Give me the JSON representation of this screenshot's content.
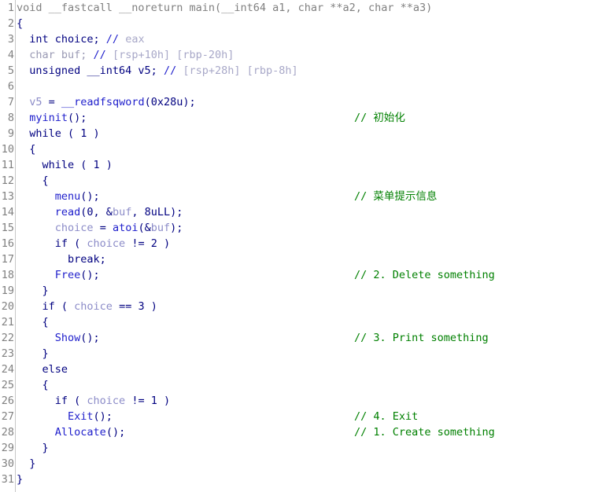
{
  "view": {
    "name": "pseudocode-view",
    "kind": "decompiler-pseudocode",
    "total_lines": 31,
    "colors": {
      "background": "#ffffff",
      "line_number": "#808080",
      "gutter_separator": "#c8c8c8",
      "keyword": "#000080",
      "function": "#2020cc",
      "local_variable": "#8c8cc8",
      "comment_slashes": "#2020cc",
      "comment_text": "#a8a8c8",
      "user_comment": "#008000",
      "prototype_dim": "#808080"
    }
  },
  "lines": [
    {
      "num": "1",
      "tokens": [
        {
          "t": "void __fastcall __noreturn main(__int64 a1, char **a2, char **a3)",
          "c": "t-proto"
        }
      ],
      "comment": ""
    },
    {
      "num": "2",
      "tokens": [
        {
          "t": "{",
          "c": "t-punct"
        }
      ],
      "comment": ""
    },
    {
      "num": "3",
      "tokens": [
        {
          "t": "  int choice; ",
          "c": "t-keyword"
        },
        {
          "t": "// ",
          "c": "t-cmt"
        },
        {
          "t": "eax",
          "c": "t-cmtbody"
        }
      ],
      "comment": ""
    },
    {
      "num": "4",
      "tokens": [
        {
          "t": "  char buf; ",
          "c": "t-dim"
        },
        {
          "t": "// ",
          "c": "t-cmt"
        },
        {
          "t": "[rsp+10h] [rbp-20h]",
          "c": "t-cmtbody"
        }
      ],
      "comment": ""
    },
    {
      "num": "5",
      "tokens": [
        {
          "t": "  unsigned __int64 v5; ",
          "c": "t-keyword"
        },
        {
          "t": "// ",
          "c": "t-cmt"
        },
        {
          "t": "[rsp+28h] [rbp-8h]",
          "c": "t-cmtbody"
        }
      ],
      "comment": ""
    },
    {
      "num": "6",
      "tokens": [],
      "comment": ""
    },
    {
      "num": "7",
      "tokens": [
        {
          "t": "  ",
          "c": "t-plain"
        },
        {
          "t": "v5",
          "c": "t-var"
        },
        {
          "t": " = ",
          "c": "t-punct"
        },
        {
          "t": "__readfsqword",
          "c": "t-func"
        },
        {
          "t": "(0x28u);",
          "c": "t-punct"
        }
      ],
      "comment": ""
    },
    {
      "num": "8",
      "tokens": [
        {
          "t": "  ",
          "c": "t-plain"
        },
        {
          "t": "myinit",
          "c": "t-func"
        },
        {
          "t": "();",
          "c": "t-punct"
        }
      ],
      "comment": "// 初始化"
    },
    {
      "num": "9",
      "tokens": [
        {
          "t": "  while ( 1 )",
          "c": "t-keyword"
        }
      ],
      "comment": ""
    },
    {
      "num": "10",
      "tokens": [
        {
          "t": "  {",
          "c": "t-punct"
        }
      ],
      "comment": ""
    },
    {
      "num": "11",
      "tokens": [
        {
          "t": "    while ( 1 )",
          "c": "t-keyword"
        }
      ],
      "comment": ""
    },
    {
      "num": "12",
      "tokens": [
        {
          "t": "    {",
          "c": "t-punct"
        }
      ],
      "comment": ""
    },
    {
      "num": "13",
      "tokens": [
        {
          "t": "      ",
          "c": "t-plain"
        },
        {
          "t": "menu",
          "c": "t-func"
        },
        {
          "t": "();",
          "c": "t-punct"
        }
      ],
      "comment": "// 菜单提示信息"
    },
    {
      "num": "14",
      "tokens": [
        {
          "t": "      ",
          "c": "t-plain"
        },
        {
          "t": "read",
          "c": "t-func"
        },
        {
          "t": "(0, &",
          "c": "t-punct"
        },
        {
          "t": "buf",
          "c": "t-var"
        },
        {
          "t": ", 8uLL);",
          "c": "t-punct"
        }
      ],
      "comment": ""
    },
    {
      "num": "15",
      "tokens": [
        {
          "t": "      ",
          "c": "t-plain"
        },
        {
          "t": "choice",
          "c": "t-var"
        },
        {
          "t": " = ",
          "c": "t-punct"
        },
        {
          "t": "atoi",
          "c": "t-func"
        },
        {
          "t": "(&",
          "c": "t-punct"
        },
        {
          "t": "buf",
          "c": "t-var"
        },
        {
          "t": ");",
          "c": "t-punct"
        }
      ],
      "comment": ""
    },
    {
      "num": "16",
      "tokens": [
        {
          "t": "      if ( ",
          "c": "t-keyword"
        },
        {
          "t": "choice",
          "c": "t-var"
        },
        {
          "t": " != 2 )",
          "c": "t-punct"
        }
      ],
      "comment": ""
    },
    {
      "num": "17",
      "tokens": [
        {
          "t": "        break;",
          "c": "t-keyword"
        }
      ],
      "comment": ""
    },
    {
      "num": "18",
      "tokens": [
        {
          "t": "      ",
          "c": "t-plain"
        },
        {
          "t": "Free",
          "c": "t-func"
        },
        {
          "t": "();",
          "c": "t-punct"
        }
      ],
      "comment": "// 2. Delete something"
    },
    {
      "num": "19",
      "tokens": [
        {
          "t": "    }",
          "c": "t-punct"
        }
      ],
      "comment": ""
    },
    {
      "num": "20",
      "tokens": [
        {
          "t": "    if ( ",
          "c": "t-keyword"
        },
        {
          "t": "choice",
          "c": "t-var"
        },
        {
          "t": " == 3 )",
          "c": "t-punct"
        }
      ],
      "comment": ""
    },
    {
      "num": "21",
      "tokens": [
        {
          "t": "    {",
          "c": "t-punct"
        }
      ],
      "comment": ""
    },
    {
      "num": "22",
      "tokens": [
        {
          "t": "      ",
          "c": "t-plain"
        },
        {
          "t": "Show",
          "c": "t-func"
        },
        {
          "t": "();",
          "c": "t-punct"
        }
      ],
      "comment": "// 3. Print something"
    },
    {
      "num": "23",
      "tokens": [
        {
          "t": "    }",
          "c": "t-punct"
        }
      ],
      "comment": ""
    },
    {
      "num": "24",
      "tokens": [
        {
          "t": "    else",
          "c": "t-keyword"
        }
      ],
      "comment": ""
    },
    {
      "num": "25",
      "tokens": [
        {
          "t": "    {",
          "c": "t-punct"
        }
      ],
      "comment": ""
    },
    {
      "num": "26",
      "tokens": [
        {
          "t": "      if ( ",
          "c": "t-keyword"
        },
        {
          "t": "choice",
          "c": "t-var"
        },
        {
          "t": " != 1 )",
          "c": "t-punct"
        }
      ],
      "comment": ""
    },
    {
      "num": "27",
      "tokens": [
        {
          "t": "        ",
          "c": "t-plain"
        },
        {
          "t": "Exit",
          "c": "t-func"
        },
        {
          "t": "();",
          "c": "t-punct"
        }
      ],
      "comment": "// 4. Exit"
    },
    {
      "num": "28",
      "tokens": [
        {
          "t": "      ",
          "c": "t-plain"
        },
        {
          "t": "Allocate",
          "c": "t-func"
        },
        {
          "t": "();",
          "c": "t-punct"
        }
      ],
      "comment": "// 1. Create something"
    },
    {
      "num": "29",
      "tokens": [
        {
          "t": "    }",
          "c": "t-punct"
        }
      ],
      "comment": ""
    },
    {
      "num": "30",
      "tokens": [
        {
          "t": "  }",
          "c": "t-punct"
        }
      ],
      "comment": ""
    },
    {
      "num": "31",
      "tokens": [
        {
          "t": "}",
          "c": "t-punct"
        }
      ],
      "comment": ""
    }
  ]
}
